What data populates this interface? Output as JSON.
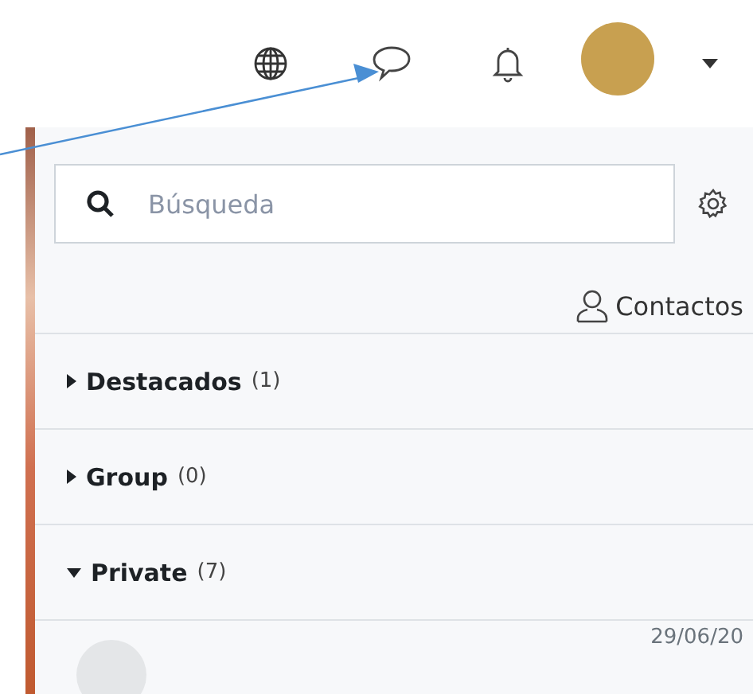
{
  "user_menu": {
    "expanded": false
  },
  "drawer": {
    "search": {
      "placeholder": "Búsqueda"
    },
    "contacts_link": "Contactos",
    "sections": [
      {
        "label": "Destacados",
        "count": "(1)",
        "expanded": false
      },
      {
        "label": "Group",
        "count": "(0)",
        "expanded": false
      },
      {
        "label": "Private",
        "count": "(7)",
        "expanded": true
      }
    ],
    "conversations": [
      {
        "date": "29/06/20"
      }
    ]
  }
}
